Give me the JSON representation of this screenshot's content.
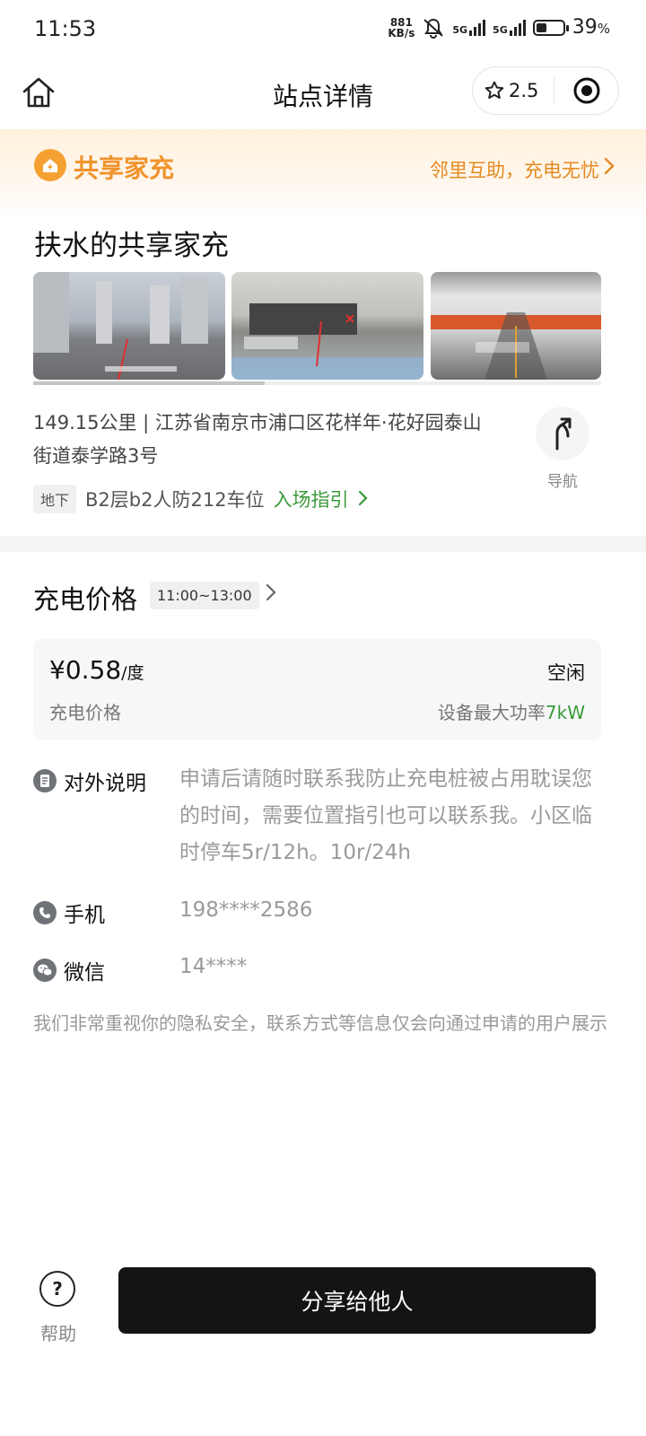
{
  "status_bar": {
    "time": "11:53",
    "net_speed_value": "881",
    "net_speed_unit": "KB/s",
    "signal1": "5G",
    "signal2": "5G",
    "battery": "39",
    "battery_unit": "%",
    "battery_level": 0.39
  },
  "header": {
    "title": "站点详情",
    "rating": "2.5",
    "home_icon": "home-icon",
    "star_icon": "star-icon",
    "target_icon": "target-icon"
  },
  "banner": {
    "brand": "共享家充",
    "slogan": "邻里互助，充电无忧",
    "colors": {
      "accent": "#f0932b"
    }
  },
  "station": {
    "name": "扶水的共享家充",
    "address": "149.15公里 | 江苏省南京市浦口区花样年·花好园泰山街道泰学路3号",
    "nav_label": "导航",
    "floor_tag": "地下",
    "floor": "B2层b2人防212车位",
    "guide": "入场指引"
  },
  "pricing": {
    "title": "充电价格",
    "time_range": "11:00~13:00",
    "price": "¥0.58",
    "price_unit": "/度",
    "price_label": "充电价格",
    "state": "空闲",
    "max_power_label": "设备最大功率",
    "max_power": "7kW"
  },
  "info": {
    "desc_label": "对外说明",
    "desc": "申请后请随时联系我防止充电桩被占用耽误您的时间，需要位置指引也可以联系我。小区临时停车5r/12h。10r/24h",
    "phone_label": "手机",
    "phone": "198****2586",
    "wechat_label": "微信",
    "wechat": "14****",
    "privacy": "我们非常重视你的隐私安全，联系方式等信息仅会向通过申请的用户展示"
  },
  "footer": {
    "help": "帮助",
    "share": "分享给他人"
  }
}
